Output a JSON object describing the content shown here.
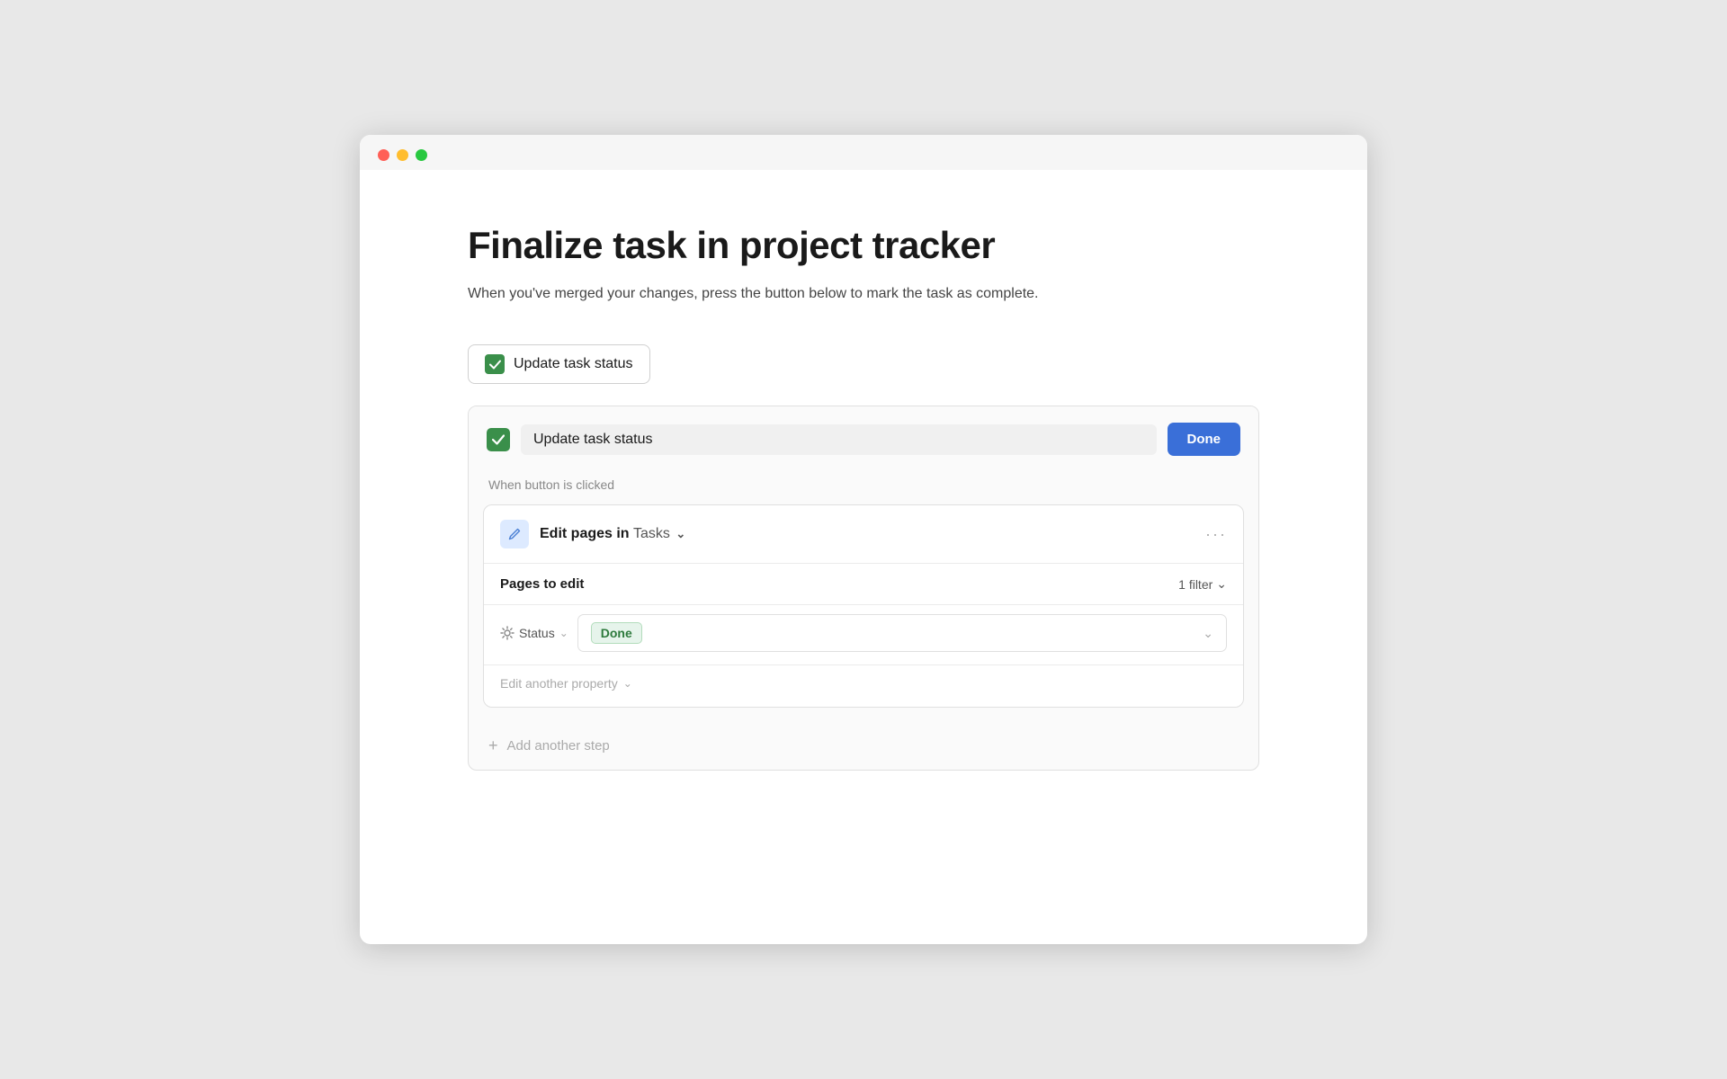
{
  "window": {
    "title": "Finalize task in project tracker"
  },
  "page": {
    "title": "Finalize task in project tracker",
    "description": "When you've merged your changes, press the button below to mark the task as complete."
  },
  "trigger_button": {
    "label": "Update task status"
  },
  "card": {
    "input_value": "Update task status",
    "input_placeholder": "Update task status",
    "done_button": "Done",
    "when_label": "When button is clicked",
    "step": {
      "edit_prefix": "Edit pages in",
      "database": "Tasks",
      "pages_to_edit": "Pages to edit",
      "filter_label": "1 filter",
      "status_label": "Status",
      "status_value": "Done",
      "edit_another": "Edit another property",
      "add_step": "Add another step"
    }
  }
}
